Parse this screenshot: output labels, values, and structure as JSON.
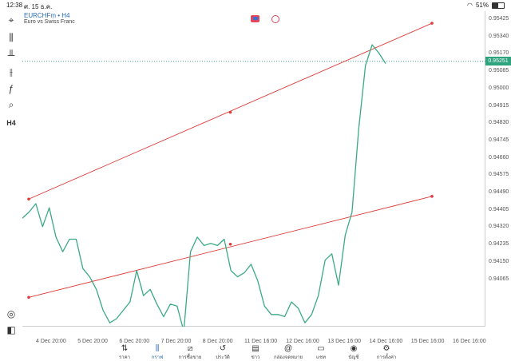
{
  "status_bar": {
    "time": "12:38",
    "date": "ศ. 15 ธ.ค.",
    "battery": "51%"
  },
  "chart_header": {
    "symbol_label": "EURCHFm • H4",
    "description": "Euro vs Swiss Franc"
  },
  "chart_data": {
    "type": "line",
    "title": "",
    "xlabel": "",
    "ylabel": "",
    "x_tick_labels": [
      "4 Dec 20:00",
      "5 Dec 20:00",
      "6 Dec 20:00",
      "7 Dec 20:00",
      "8 Dec 20:00",
      "11 Dec 16:00",
      "12 Dec 16:00",
      "13 Dec 16:00",
      "14 Dec 16:00",
      "15 Dec 16:00",
      "16 Dec 16:00"
    ],
    "y_tick_labels": [
      "0.95425",
      "0.95340",
      "0.95170",
      "0.95085",
      "0.95000",
      "0.94915",
      "0.94830",
      "0.94745",
      "0.94660",
      "0.94575",
      "0.94490",
      "0.94405",
      "0.94320",
      "0.94235",
      "0.94150",
      "0.94065"
    ],
    "ylim": [
      0.9402,
      0.9546
    ],
    "current_price": "0.95251",
    "line_color": "#3aaa82",
    "channel_color": "#e03a3a",
    "series": [
      {
        "values": [
          0.945,
          0.9453,
          0.9457,
          0.9446,
          0.9455,
          0.9441,
          0.9434,
          0.944,
          0.944,
          0.9426,
          0.9422,
          0.9416,
          0.9406,
          0.94,
          0.9402,
          0.9406,
          0.941,
          0.9425,
          0.9413,
          0.9416,
          0.9409,
          0.9403,
          0.9409,
          0.9408,
          0.9396,
          0.9434,
          0.9441,
          0.9437,
          0.9438,
          0.9437,
          0.944,
          0.9425,
          0.9422,
          0.9424,
          0.9428,
          0.942,
          0.9408,
          0.9404,
          0.9404,
          0.9403,
          0.941,
          0.9407,
          0.94,
          0.9404,
          0.9413,
          0.943,
          0.9433,
          0.9418,
          0.9442,
          0.9453,
          0.9493,
          0.9523,
          0.9533,
          0.9529,
          0.9524
        ]
      }
    ],
    "channel_lines": [
      {
        "start": [
          0.0,
          0.94592
        ],
        "end": [
          1.0,
          0.95433
        ],
        "mid_point": [
          0.5,
          0.95007
        ]
      },
      {
        "start": [
          0.0,
          0.94122
        ],
        "end": [
          1.0,
          0.94605
        ],
        "mid_point": [
          0.5,
          0.94376
        ]
      }
    ]
  },
  "toolbar": [
    {
      "name": "crosshair-icon",
      "glyph": "⌖"
    },
    {
      "name": "chart-type-icon",
      "glyph": "⫼"
    },
    {
      "name": "indicators-icon",
      "glyph": "╨"
    },
    {
      "name": "objects-icon",
      "glyph": "⫲"
    },
    {
      "name": "function-icon",
      "glyph": "ƒ"
    },
    {
      "name": "shapes-icon",
      "glyph": "⌕"
    },
    {
      "name": "timeframe-label",
      "glyph": "H4"
    },
    {
      "name": "signal-icon",
      "glyph": "◎"
    },
    {
      "name": "trade-icon",
      "glyph": "◧"
    }
  ],
  "bottom_nav": [
    {
      "label": "ราคา",
      "icon": "⇅"
    },
    {
      "label": "กราฟ",
      "icon": "⫼"
    },
    {
      "label": "การซื้อขาย",
      "icon": "⧄"
    },
    {
      "label": "ประวัติ",
      "icon": "↺"
    },
    {
      "label": "ข่าว",
      "icon": "▤"
    },
    {
      "label": "กล่องจดหมาย",
      "icon": "@"
    },
    {
      "label": "แชท",
      "icon": "▭"
    },
    {
      "label": "บัญชี",
      "icon": "◉"
    },
    {
      "label": "การตั้งค่า",
      "icon": "⚙"
    }
  ]
}
